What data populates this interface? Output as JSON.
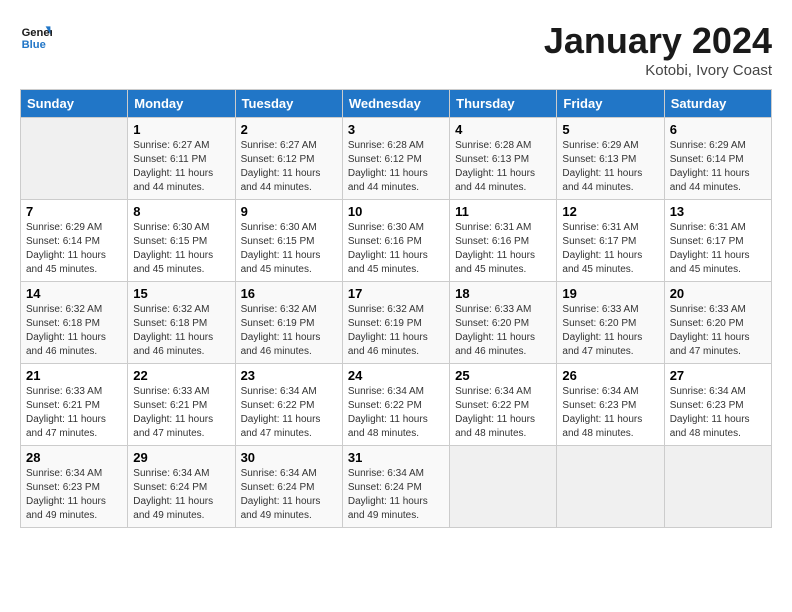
{
  "header": {
    "logo_line1": "General",
    "logo_line2": "Blue",
    "month_title": "January 2024",
    "subtitle": "Kotobi, Ivory Coast"
  },
  "days_of_week": [
    "Sunday",
    "Monday",
    "Tuesday",
    "Wednesday",
    "Thursday",
    "Friday",
    "Saturday"
  ],
  "weeks": [
    [
      {
        "day": "",
        "info": ""
      },
      {
        "day": "1",
        "info": "Sunrise: 6:27 AM\nSunset: 6:11 PM\nDaylight: 11 hours and 44 minutes."
      },
      {
        "day": "2",
        "info": "Sunrise: 6:27 AM\nSunset: 6:12 PM\nDaylight: 11 hours and 44 minutes."
      },
      {
        "day": "3",
        "info": "Sunrise: 6:28 AM\nSunset: 6:12 PM\nDaylight: 11 hours and 44 minutes."
      },
      {
        "day": "4",
        "info": "Sunrise: 6:28 AM\nSunset: 6:13 PM\nDaylight: 11 hours and 44 minutes."
      },
      {
        "day": "5",
        "info": "Sunrise: 6:29 AM\nSunset: 6:13 PM\nDaylight: 11 hours and 44 minutes."
      },
      {
        "day": "6",
        "info": "Sunrise: 6:29 AM\nSunset: 6:14 PM\nDaylight: 11 hours and 44 minutes."
      }
    ],
    [
      {
        "day": "7",
        "info": "Sunrise: 6:29 AM\nSunset: 6:14 PM\nDaylight: 11 hours and 45 minutes."
      },
      {
        "day": "8",
        "info": "Sunrise: 6:30 AM\nSunset: 6:15 PM\nDaylight: 11 hours and 45 minutes."
      },
      {
        "day": "9",
        "info": "Sunrise: 6:30 AM\nSunset: 6:15 PM\nDaylight: 11 hours and 45 minutes."
      },
      {
        "day": "10",
        "info": "Sunrise: 6:30 AM\nSunset: 6:16 PM\nDaylight: 11 hours and 45 minutes."
      },
      {
        "day": "11",
        "info": "Sunrise: 6:31 AM\nSunset: 6:16 PM\nDaylight: 11 hours and 45 minutes."
      },
      {
        "day": "12",
        "info": "Sunrise: 6:31 AM\nSunset: 6:17 PM\nDaylight: 11 hours and 45 minutes."
      },
      {
        "day": "13",
        "info": "Sunrise: 6:31 AM\nSunset: 6:17 PM\nDaylight: 11 hours and 45 minutes."
      }
    ],
    [
      {
        "day": "14",
        "info": "Sunrise: 6:32 AM\nSunset: 6:18 PM\nDaylight: 11 hours and 46 minutes."
      },
      {
        "day": "15",
        "info": "Sunrise: 6:32 AM\nSunset: 6:18 PM\nDaylight: 11 hours and 46 minutes."
      },
      {
        "day": "16",
        "info": "Sunrise: 6:32 AM\nSunset: 6:19 PM\nDaylight: 11 hours and 46 minutes."
      },
      {
        "day": "17",
        "info": "Sunrise: 6:32 AM\nSunset: 6:19 PM\nDaylight: 11 hours and 46 minutes."
      },
      {
        "day": "18",
        "info": "Sunrise: 6:33 AM\nSunset: 6:20 PM\nDaylight: 11 hours and 46 minutes."
      },
      {
        "day": "19",
        "info": "Sunrise: 6:33 AM\nSunset: 6:20 PM\nDaylight: 11 hours and 47 minutes."
      },
      {
        "day": "20",
        "info": "Sunrise: 6:33 AM\nSunset: 6:20 PM\nDaylight: 11 hours and 47 minutes."
      }
    ],
    [
      {
        "day": "21",
        "info": "Sunrise: 6:33 AM\nSunset: 6:21 PM\nDaylight: 11 hours and 47 minutes."
      },
      {
        "day": "22",
        "info": "Sunrise: 6:33 AM\nSunset: 6:21 PM\nDaylight: 11 hours and 47 minutes."
      },
      {
        "day": "23",
        "info": "Sunrise: 6:34 AM\nSunset: 6:22 PM\nDaylight: 11 hours and 47 minutes."
      },
      {
        "day": "24",
        "info": "Sunrise: 6:34 AM\nSunset: 6:22 PM\nDaylight: 11 hours and 48 minutes."
      },
      {
        "day": "25",
        "info": "Sunrise: 6:34 AM\nSunset: 6:22 PM\nDaylight: 11 hours and 48 minutes."
      },
      {
        "day": "26",
        "info": "Sunrise: 6:34 AM\nSunset: 6:23 PM\nDaylight: 11 hours and 48 minutes."
      },
      {
        "day": "27",
        "info": "Sunrise: 6:34 AM\nSunset: 6:23 PM\nDaylight: 11 hours and 48 minutes."
      }
    ],
    [
      {
        "day": "28",
        "info": "Sunrise: 6:34 AM\nSunset: 6:23 PM\nDaylight: 11 hours and 49 minutes."
      },
      {
        "day": "29",
        "info": "Sunrise: 6:34 AM\nSunset: 6:24 PM\nDaylight: 11 hours and 49 minutes."
      },
      {
        "day": "30",
        "info": "Sunrise: 6:34 AM\nSunset: 6:24 PM\nDaylight: 11 hours and 49 minutes."
      },
      {
        "day": "31",
        "info": "Sunrise: 6:34 AM\nSunset: 6:24 PM\nDaylight: 11 hours and 49 minutes."
      },
      {
        "day": "",
        "info": ""
      },
      {
        "day": "",
        "info": ""
      },
      {
        "day": "",
        "info": ""
      }
    ]
  ]
}
